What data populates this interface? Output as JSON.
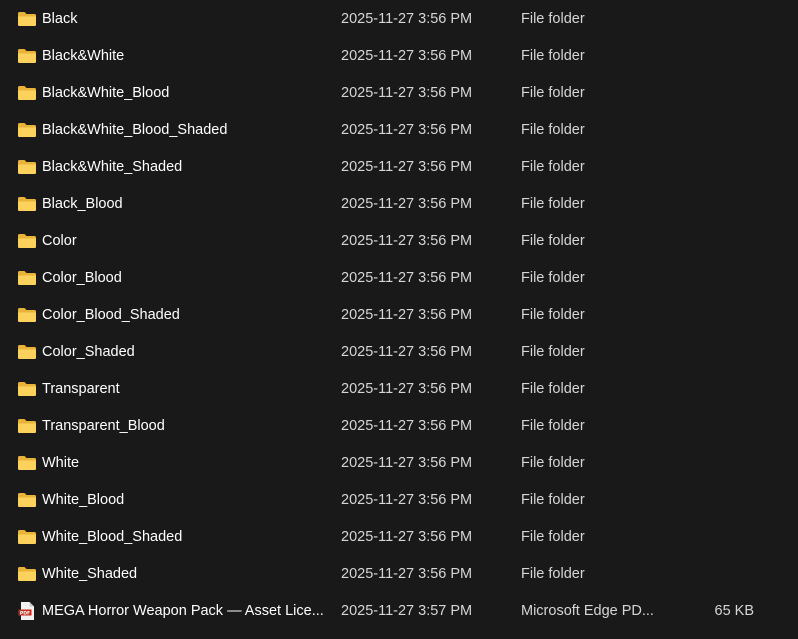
{
  "files": [
    {
      "name": "Black",
      "date": "2025-11-27 3:56 PM",
      "type": "File folder",
      "size": "",
      "icon": "folder-icon"
    },
    {
      "name": "Black&White",
      "date": "2025-11-27 3:56 PM",
      "type": "File folder",
      "size": "",
      "icon": "folder-icon"
    },
    {
      "name": "Black&White_Blood",
      "date": "2025-11-27 3:56 PM",
      "type": "File folder",
      "size": "",
      "icon": "folder-icon"
    },
    {
      "name": "Black&White_Blood_Shaded",
      "date": "2025-11-27 3:56 PM",
      "type": "File folder",
      "size": "",
      "icon": "folder-icon"
    },
    {
      "name": "Black&White_Shaded",
      "date": "2025-11-27 3:56 PM",
      "type": "File folder",
      "size": "",
      "icon": "folder-icon"
    },
    {
      "name": "Black_Blood",
      "date": "2025-11-27 3:56 PM",
      "type": "File folder",
      "size": "",
      "icon": "folder-icon"
    },
    {
      "name": "Color",
      "date": "2025-11-27 3:56 PM",
      "type": "File folder",
      "size": "",
      "icon": "folder-icon"
    },
    {
      "name": "Color_Blood",
      "date": "2025-11-27 3:56 PM",
      "type": "File folder",
      "size": "",
      "icon": "folder-icon"
    },
    {
      "name": "Color_Blood_Shaded",
      "date": "2025-11-27 3:56 PM",
      "type": "File folder",
      "size": "",
      "icon": "folder-icon"
    },
    {
      "name": "Color_Shaded",
      "date": "2025-11-27 3:56 PM",
      "type": "File folder",
      "size": "",
      "icon": "folder-icon"
    },
    {
      "name": "Transparent",
      "date": "2025-11-27 3:56 PM",
      "type": "File folder",
      "size": "",
      "icon": "folder-icon"
    },
    {
      "name": "Transparent_Blood",
      "date": "2025-11-27 3:56 PM",
      "type": "File folder",
      "size": "",
      "icon": "folder-icon"
    },
    {
      "name": "White",
      "date": "2025-11-27 3:56 PM",
      "type": "File folder",
      "size": "",
      "icon": "folder-icon"
    },
    {
      "name": "White_Blood",
      "date": "2025-11-27 3:56 PM",
      "type": "File folder",
      "size": "",
      "icon": "folder-icon"
    },
    {
      "name": "White_Blood_Shaded",
      "date": "2025-11-27 3:56 PM",
      "type": "File folder",
      "size": "",
      "icon": "folder-icon"
    },
    {
      "name": "White_Shaded",
      "date": "2025-11-27 3:56 PM",
      "type": "File folder",
      "size": "",
      "icon": "folder-icon"
    },
    {
      "name": "MEGA Horror Weapon Pack — Asset Lice...",
      "date": "2025-11-27 3:57 PM",
      "type": "Microsoft Edge PD...",
      "size": "65 KB",
      "icon": "pdf-icon",
      "icon_label": "PDF"
    }
  ],
  "colors": {
    "background": "#191919",
    "text_primary": "#ffffff",
    "text_secondary": "#d6d6d6",
    "folder_accent": "#f8cf54",
    "pdf_accent": "#c42b1c"
  }
}
